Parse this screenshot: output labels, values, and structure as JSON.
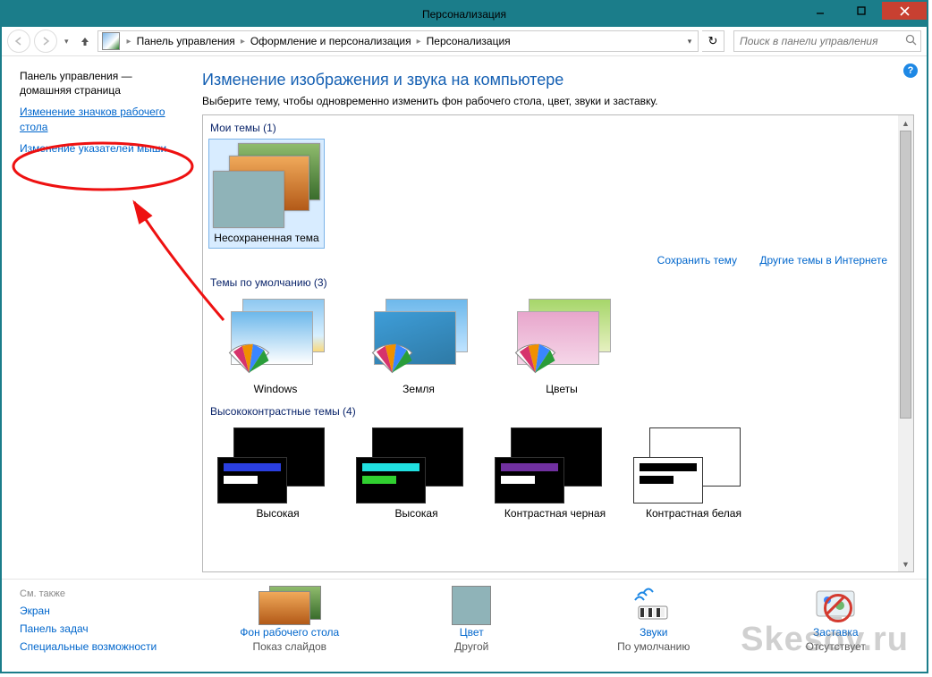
{
  "titlebar": {
    "title": "Персонализация"
  },
  "toolbar": {
    "breadcrumbs": {
      "root": "Панель управления",
      "mid": "Оформление и персонализация",
      "leaf": "Персонализация"
    },
    "search_placeholder": "Поиск в панели управления"
  },
  "sidebar": {
    "home_line1": "Панель управления —",
    "home_line2": "домашняя страница",
    "link_icons_line1": "Изменение значков рабочего",
    "link_icons_line2": "стола",
    "link_cursors": "Изменение указателей мыши"
  },
  "main": {
    "heading": "Изменение изображения и звука на компьютере",
    "subtitle": "Выберите тему, чтобы одновременно изменить фон рабочего стола, цвет, звуки и заставку.",
    "sec_my": "Мои темы (1)",
    "my_theme_caption": "Несохраненная тема",
    "save_theme": "Сохранить тему",
    "more_themes": "Другие темы в Интернете",
    "sec_default": "Темы по умолчанию (3)",
    "def1": "Windows",
    "def2": "Земля",
    "def3": "Цветы",
    "sec_hc": "Высококонтрастные темы (4)",
    "hc1": "Высокая",
    "hc2": "Высокая",
    "hc3": "Контрастная черная",
    "hc4": "Контрастная белая"
  },
  "bottom": {
    "see_also": "См. также",
    "link_screen": "Экран",
    "link_taskbar": "Панель задач",
    "link_access": "Специальные возможности",
    "opt_bg_label": "Фон рабочего стола",
    "opt_bg_sub": "Показ слайдов",
    "opt_color_label": "Цвет",
    "opt_color_sub": "Другой",
    "opt_sound_label": "Звуки",
    "opt_sound_sub": "По умолчанию",
    "opt_saver_label": "Заставка",
    "opt_saver_sub": "Отсутствует"
  },
  "watermark": "Skesov.ru"
}
